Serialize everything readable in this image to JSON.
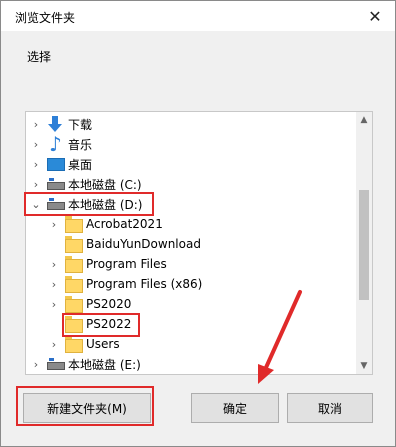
{
  "window": {
    "title": "浏览文件夹",
    "close_glyph": "✕"
  },
  "prompt": "选择\u0000",
  "tree": {
    "items": [
      {
        "chevron": "›",
        "icon": "down-arrow-icon",
        "label": "下载"
      },
      {
        "chevron": "›",
        "icon": "music-icon",
        "label": "音乐"
      },
      {
        "chevron": "›",
        "icon": "desktop-icon",
        "label": "桌面"
      },
      {
        "chevron": "›",
        "icon": "drive-icon",
        "label": "本地磁盘 (C:)"
      },
      {
        "chevron": "⌄",
        "icon": "drive-icon",
        "label": "本地磁盘 (D:)"
      },
      {
        "chevron": "›",
        "icon": "folder-icon",
        "label": "Acrobat2021"
      },
      {
        "chevron": "",
        "icon": "folder-icon",
        "label": "BaiduYunDownload"
      },
      {
        "chevron": "›",
        "icon": "folder-icon",
        "label": "Program Files"
      },
      {
        "chevron": "›",
        "icon": "folder-icon",
        "label": "Program Files (x86)"
      },
      {
        "chevron": "›",
        "icon": "folder-icon",
        "label": "PS2020"
      },
      {
        "chevron": "",
        "icon": "folder-icon",
        "label": "PS2022"
      },
      {
        "chevron": "›",
        "icon": "folder-icon",
        "label": "Users"
      },
      {
        "chevron": "›",
        "icon": "drive-icon",
        "label": "本地磁盘 (E:)"
      }
    ]
  },
  "buttons": {
    "new_folder": "新建文件夹(M)",
    "ok": "确定",
    "cancel": "取消"
  },
  "colors": {
    "highlight": "#e02a2a",
    "accent": "#2d7fd7",
    "folder": "#ffd766"
  }
}
